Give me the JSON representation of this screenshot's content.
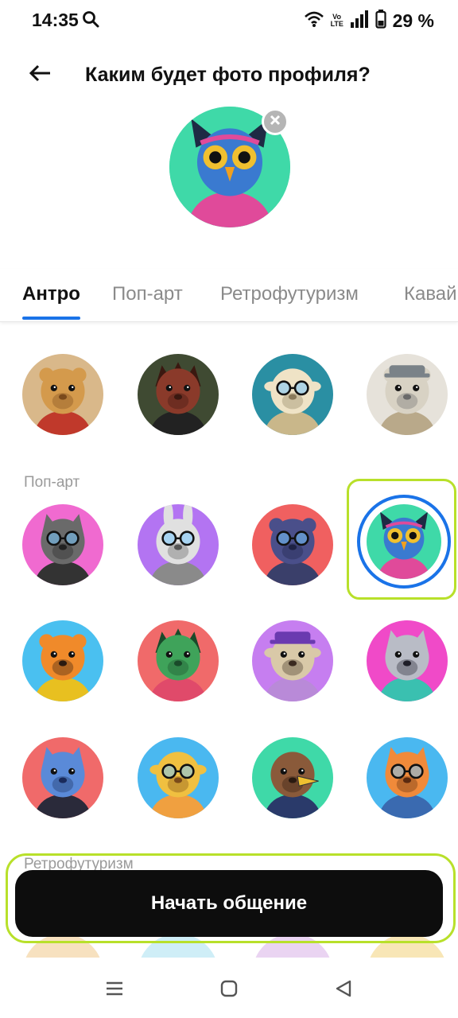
{
  "status_bar": {
    "time": "14:35",
    "network_label": "Vo LTE",
    "battery_percent": "29 %",
    "icons": [
      "search-icon",
      "wifi-icon",
      "signal-icon",
      "battery-icon"
    ]
  },
  "header": {
    "title": "Каким будет фото профиля?",
    "back_icon": "arrow-left-icon"
  },
  "preview": {
    "avatar": "owl",
    "remove_icon": "close-icon"
  },
  "tabs": [
    {
      "label": "Антро",
      "active": true
    },
    {
      "label": "Поп-арт",
      "active": false
    },
    {
      "label": "Ретрофутуризм",
      "active": false
    },
    {
      "label": "Кавай",
      "active": false
    }
  ],
  "sections": [
    {
      "label": "",
      "avatars": [
        "lioness",
        "hedgehog",
        "sheep",
        "snow-leopard"
      ]
    },
    {
      "label": "Поп-арт",
      "avatars": [
        "cat",
        "rabbit",
        "bear",
        "owl",
        "tiger",
        "dragon",
        "pug",
        "raccoon",
        "wolf",
        "giraffe",
        "eagle",
        "fox"
      ]
    },
    {
      "label": "Ретрофутуризм",
      "avatars": []
    }
  ],
  "selected_avatar": "owl",
  "cta": {
    "label": "Начать общение"
  },
  "nav_bar": {
    "icons": [
      "menu-icon",
      "home-icon",
      "back-triangle-icon"
    ]
  },
  "colors": {
    "accent": "#1a73e8",
    "highlight": "#b8e02a",
    "cta_background": "#0d0d0d"
  }
}
